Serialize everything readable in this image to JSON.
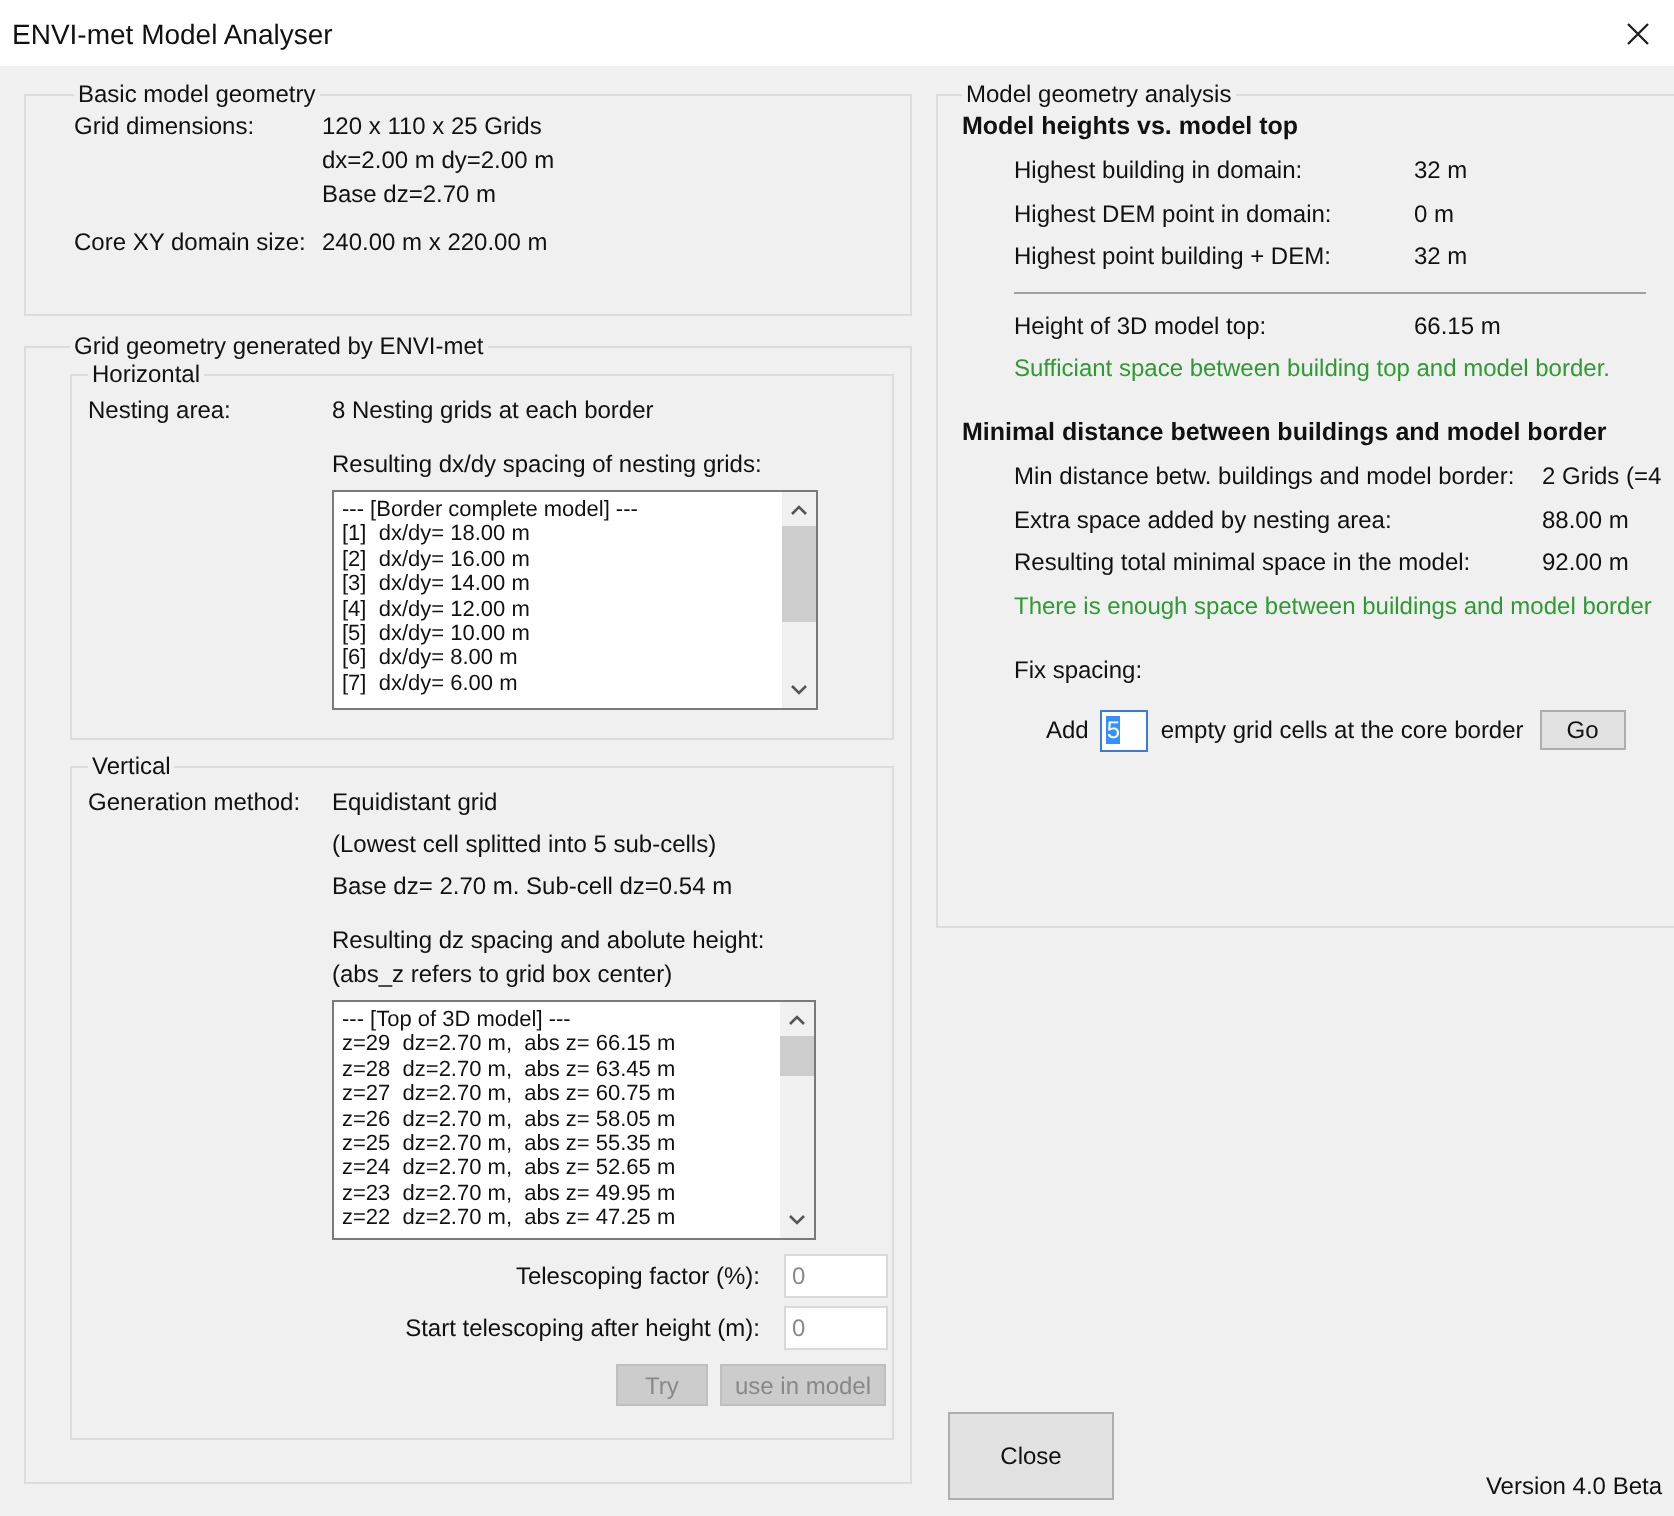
{
  "window": {
    "title": "ENVI-met Model Analyser"
  },
  "basic": {
    "title": "Basic model geometry",
    "rows": [
      {
        "label": "Grid dimensions:",
        "values": [
          "120 x 110 x 25 Grids",
          "dx=2.00 m  dy=2.00 m",
          "Base dz=2.70 m"
        ]
      },
      {
        "label": "Core XY domain size:",
        "values": [
          "240.00 m x 220.00 m"
        ]
      }
    ]
  },
  "grid": {
    "title": "Grid geometry generated by ENVI-met",
    "horizontal": {
      "title": "Horizontal",
      "label": "Nesting area:",
      "value": "8 Nesting grids at each border",
      "captions": [
        "Resulting dx/dy spacing of nesting grids:"
      ],
      "list": [
        "--- [Border complete model] ---",
        "[1]  dx/dy= 18.00 m",
        "[2]  dx/dy= 16.00 m",
        "[3]  dx/dy= 14.00 m",
        "[4]  dx/dy= 12.00 m",
        "[5]  dx/dy= 10.00 m",
        "[6]  dx/dy= 8.00 m",
        "[7]  dx/dy= 6.00 m"
      ]
    },
    "vertical": {
      "title": "Vertical",
      "label": "Generation method:",
      "lines": [
        "Equidistant grid",
        "(Lowest cell splitted into 5 sub-cells)",
        "Base dz= 2.70 m. Sub-cell dz=0.54 m"
      ],
      "captions": [
        "Resulting dz spacing and abolute height:",
        "(abs_z refers to grid box center)"
      ],
      "list": [
        "--- [Top of 3D model] ---",
        "z=29  dz=2.70 m,  abs z= 66.15 m",
        "z=28  dz=2.70 m,  abs z= 63.45 m",
        "z=27  dz=2.70 m,  abs z= 60.75 m",
        "z=26  dz=2.70 m,  abs z= 58.05 m",
        "z=25  dz=2.70 m,  abs z= 55.35 m",
        "z=24  dz=2.70 m,  abs z= 52.65 m",
        "z=23  dz=2.70 m,  abs z= 49.95 m",
        "z=22  dz=2.70 m,  abs z= 47.25 m"
      ],
      "fields": [
        {
          "label": "Telescoping factor (%):",
          "value": "0"
        },
        {
          "label": "Start telescoping after height (m):",
          "value": "0"
        }
      ],
      "buttons": [
        {
          "label": "Try",
          "disabled": true
        },
        {
          "label": "use in model",
          "disabled": true
        }
      ]
    }
  },
  "analysis": {
    "title": "Model geometry analysis",
    "sections": [
      {
        "heading": "Model heights vs. model top",
        "rows": [
          {
            "kind": "row",
            "label": "Highest building in domain:",
            "value": "32 m"
          },
          {
            "kind": "row",
            "label": "Highest DEM point in domain:",
            "value": "0 m"
          },
          {
            "kind": "row",
            "label": "Highest point building + DEM:",
            "value": "32 m"
          },
          {
            "kind": "divider"
          },
          {
            "kind": "row",
            "label": "Height of 3D model top:",
            "value": "66.15 m"
          }
        ],
        "message": {
          "text": "Sufficiant space between building top and model border.",
          "ok": true
        }
      },
      {
        "heading": "Minimal distance between buildings and model border",
        "rows": [
          {
            "kind": "wide",
            "label": "Min distance betw. buildings and model border:",
            "value": "2 Grids (=4"
          },
          {
            "kind": "wide",
            "label": "Extra space added by nesting area:",
            "value": "88.00 m"
          },
          {
            "kind": "wide",
            "label": "Resulting total minimal space in the model:",
            "value": "92.00 m"
          }
        ],
        "message": {
          "text": "There is enough space between buildings and model border",
          "ok": true
        }
      }
    ],
    "fix": {
      "label": "Fix spacing:",
      "prefix": "Add",
      "value": "5",
      "value_selected": true,
      "suffix": "empty grid cells at the core border",
      "button": "Go"
    }
  },
  "close_button": "Close",
  "version": "Version 4.0 Beta"
}
